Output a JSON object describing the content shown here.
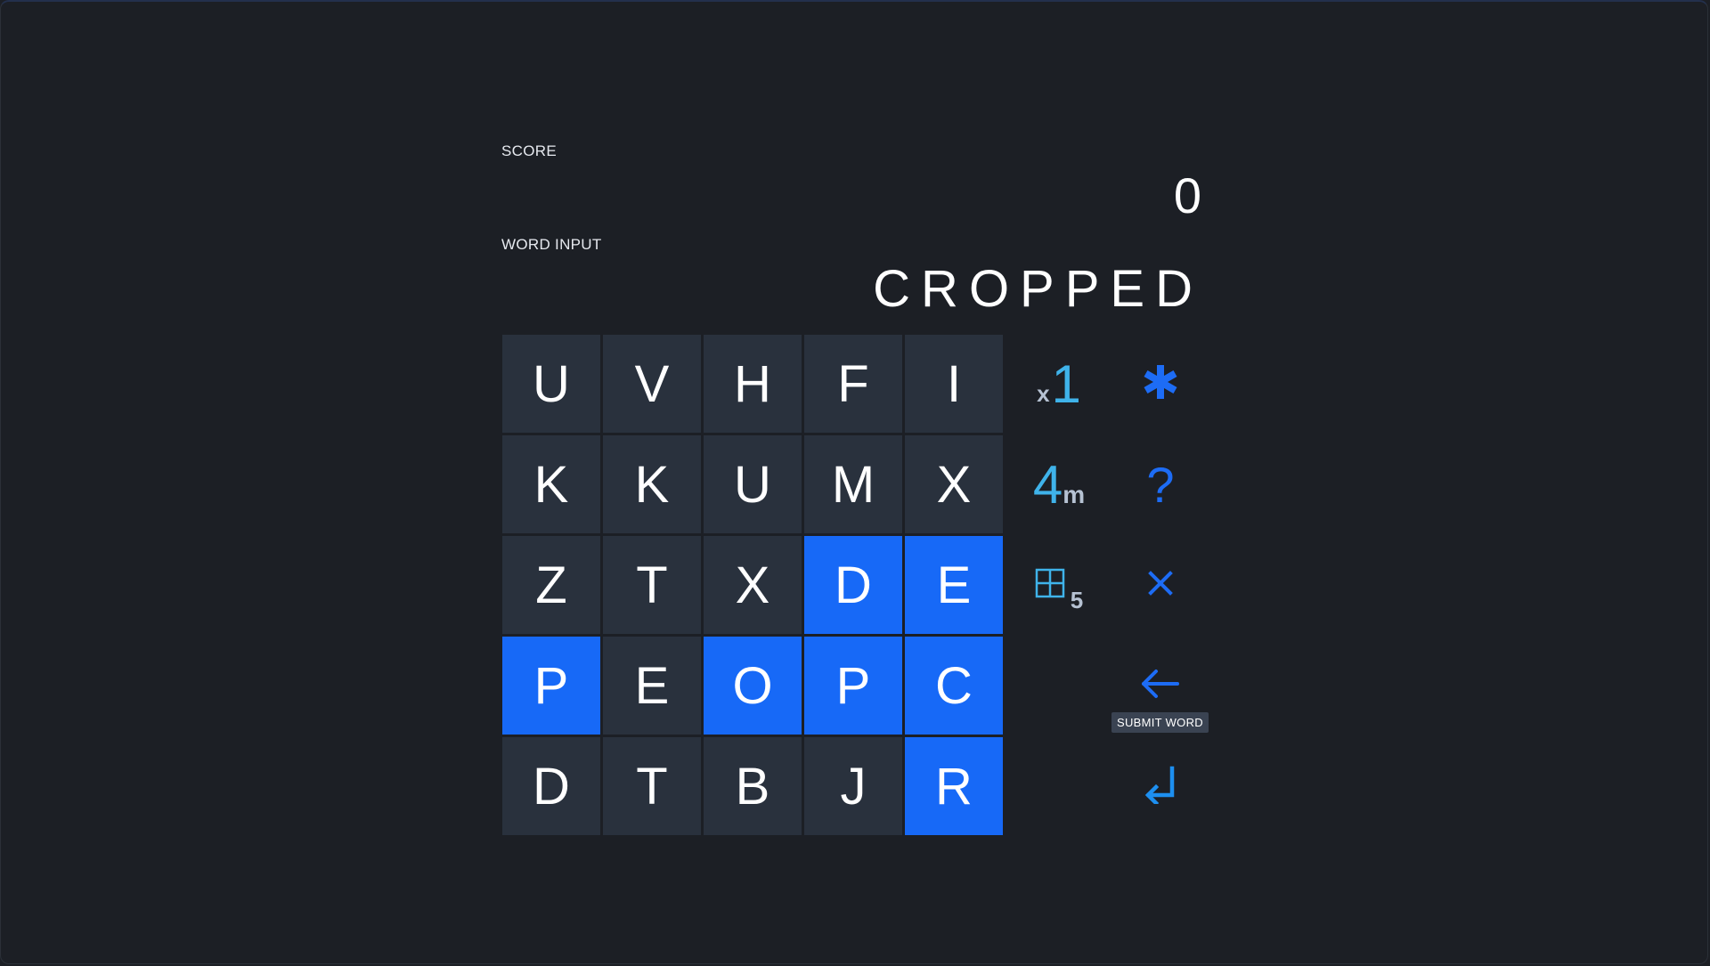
{
  "score": {
    "label": "SCORE",
    "value": "0"
  },
  "word_input": {
    "label": "WORD INPUT",
    "value": "CROPPED"
  },
  "grid": {
    "rows": [
      [
        {
          "letter": "U",
          "selected": false
        },
        {
          "letter": "V",
          "selected": false
        },
        {
          "letter": "H",
          "selected": false
        },
        {
          "letter": "F",
          "selected": false
        },
        {
          "letter": "I",
          "selected": false
        }
      ],
      [
        {
          "letter": "K",
          "selected": false
        },
        {
          "letter": "K",
          "selected": false
        },
        {
          "letter": "U",
          "selected": false
        },
        {
          "letter": "M",
          "selected": false
        },
        {
          "letter": "X",
          "selected": false
        }
      ],
      [
        {
          "letter": "Z",
          "selected": false
        },
        {
          "letter": "T",
          "selected": false
        },
        {
          "letter": "X",
          "selected": false
        },
        {
          "letter": "D",
          "selected": true
        },
        {
          "letter": "E",
          "selected": true
        }
      ],
      [
        {
          "letter": "P",
          "selected": true
        },
        {
          "letter": "E",
          "selected": false
        },
        {
          "letter": "O",
          "selected": true
        },
        {
          "letter": "P",
          "selected": true
        },
        {
          "letter": "C",
          "selected": true
        }
      ],
      [
        {
          "letter": "D",
          "selected": false
        },
        {
          "letter": "T",
          "selected": false
        },
        {
          "letter": "B",
          "selected": false
        },
        {
          "letter": "J",
          "selected": false
        },
        {
          "letter": "R",
          "selected": true
        }
      ]
    ]
  },
  "status": {
    "multiplier_prefix": "x",
    "multiplier_value": "1",
    "time_value": "4",
    "time_unit": "m",
    "grid_size": "5",
    "grid_icon": "grid-icon"
  },
  "controls": {
    "wildcard_icon": "asterisk-icon",
    "hint_label": "?",
    "clear_icon": "close-icon",
    "backspace_icon": "arrow-left-icon",
    "submit_icon": "enter-icon",
    "submit_tooltip": "SUBMIT WORD"
  },
  "colors": {
    "background": "#1c1f25",
    "tile": "#29313d",
    "tile_selected": "#1769f7",
    "accent_cyan": "#3fb3ea",
    "accent_blue": "#1d6cf5"
  }
}
